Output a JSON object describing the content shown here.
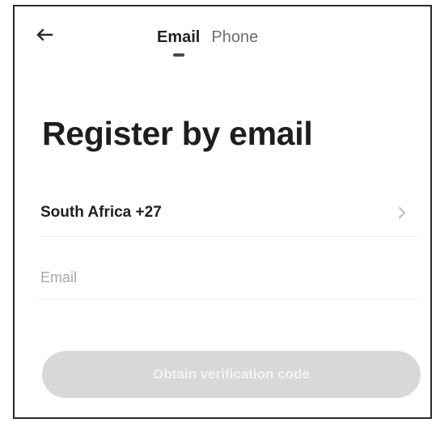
{
  "header": {
    "back_icon": "arrow-left-icon",
    "tabs": [
      {
        "label": "Email",
        "active": true
      },
      {
        "label": "Phone",
        "active": false
      }
    ]
  },
  "main": {
    "title": "Register by email",
    "country": {
      "label": "South Africa +27",
      "icon": "chevron-right-icon"
    },
    "email": {
      "value": "",
      "placeholder": "Email"
    },
    "primary_button": {
      "label": "Obtain verification code"
    }
  },
  "colors": {
    "button_disabled": "#d8d8d8",
    "button_text": "#f3f3f3",
    "text_primary": "#1e1e1e",
    "text_secondary": "#6d6d6d",
    "divider": "#ececec"
  }
}
